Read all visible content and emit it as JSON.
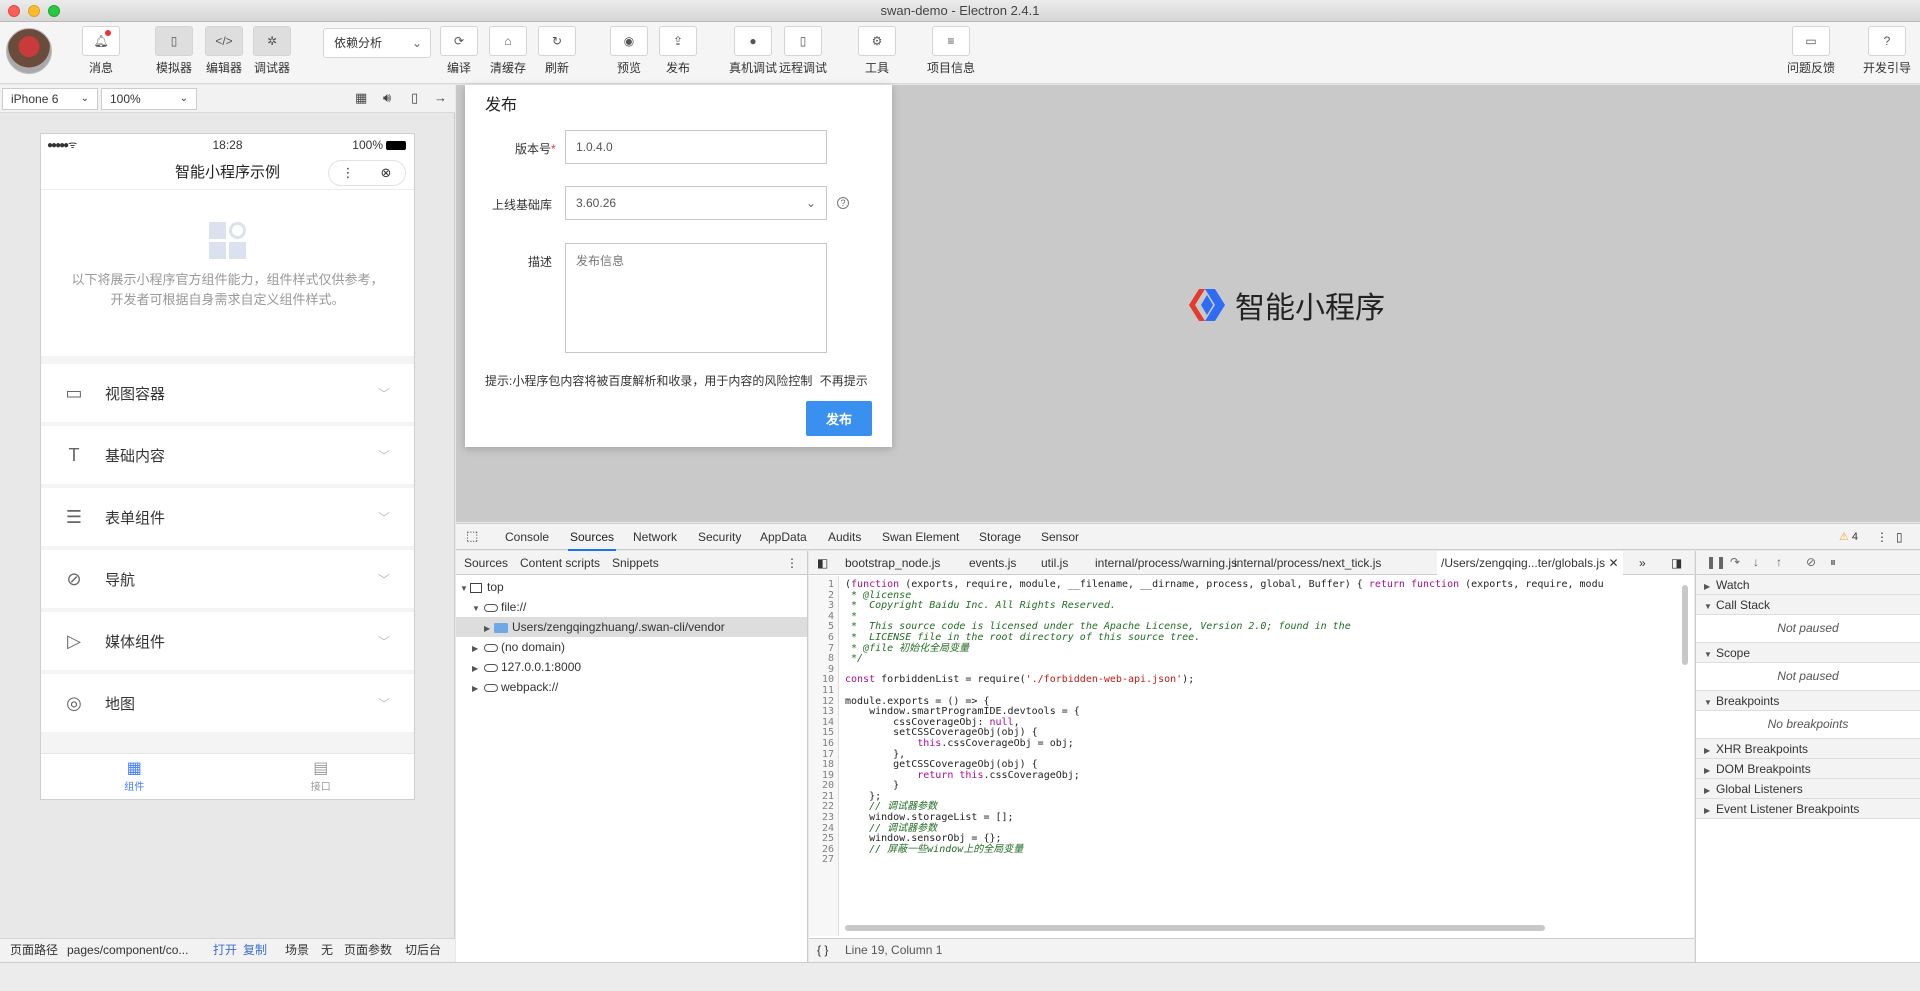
{
  "window": {
    "title": "swan-demo - Electron 2.4.1"
  },
  "toolbar": {
    "message": "消息",
    "simulator": "模拟器",
    "editor": "编辑器",
    "debugger": "调试器",
    "compile_mode": "依赖分析",
    "compile": "编译",
    "clear_cache": "清缓存",
    "refresh": "刷新",
    "preview": "预览",
    "publish": "发布",
    "device_debug": "真机调试",
    "remote_debug": "远程调试",
    "tools": "工具",
    "project_info": "项目信息",
    "feedback": "问题反馈",
    "dev_guide": "开发引导"
  },
  "simulator": {
    "device": "iPhone 6",
    "zoom": "100%"
  },
  "phone": {
    "status_time": "18:28",
    "battery": "100%",
    "signal": "●●●●● ᯤ",
    "nav_title": "智能小程序示例",
    "capsule_menu": "⋮",
    "capsule_close": "⊗",
    "intro_line1": "以下将展示小程序官方组件能力，组件样式仅供参考，",
    "intro_line2": "开发者可根据自身需求自定义组件样式。",
    "items": [
      {
        "label": "视图容器"
      },
      {
        "label": "基础内容"
      },
      {
        "label": "表单组件"
      },
      {
        "label": "导航"
      },
      {
        "label": "媒体组件"
      },
      {
        "label": "地图"
      }
    ],
    "tabs": [
      {
        "label": "组件"
      },
      {
        "label": "接口"
      }
    ]
  },
  "sim_footer": {
    "path_label": "页面路径",
    "path_value": "pages/component/co...",
    "open": "打开",
    "copy": "复制",
    "scene": "场景",
    "scene_value": "无",
    "page_params": "页面参数",
    "background": "切后台"
  },
  "publish_dialog": {
    "title": "发布",
    "version_label": "版本号",
    "required_mark": "*",
    "version_value": "1.0.4.0",
    "lib_label": "上线基础库",
    "lib_value": "3.60.26",
    "desc_label": "描述",
    "desc_placeholder": "发布信息",
    "hint": "提示:小程序包内容将被百度解析和收录，用于内容的风险控制",
    "dismiss": "不再提示",
    "submit": "发布"
  },
  "brand": {
    "name": "智能小程序"
  },
  "devtools": {
    "tabs": [
      "Console",
      "Sources",
      "Network",
      "Security",
      "AppData",
      "Audits",
      "Swan Element",
      "Storage",
      "Sensor"
    ],
    "active_tab": "Sources",
    "warnings": "4",
    "nav_tabs": [
      "Sources",
      "Content scripts",
      "Snippets"
    ],
    "tree": {
      "top": "top",
      "file": "file://",
      "folder": "Users/zengqingzhuang/.swan-cli/vendor",
      "no_domain": "(no domain)",
      "local": "127.0.0.1:8000",
      "webpack": "webpack://"
    },
    "files": [
      "bootstrap_node.js",
      "events.js",
      "util.js",
      "internal/process/warning.js",
      "internal/process/next_tick.js",
      "/Users/zengqing...ter/globals.js"
    ],
    "cursor": "Line 19, Column 1",
    "format_btn": "{ }",
    "debug_sections": {
      "watch": "Watch",
      "call_stack": "Call Stack",
      "not_paused_1": "Not paused",
      "scope": "Scope",
      "not_paused_2": "Not paused",
      "breakpoints": "Breakpoints",
      "no_breakpoints": "No breakpoints",
      "xhr": "XHR Breakpoints",
      "dom": "DOM Breakpoints",
      "global": "Global Listeners",
      "event": "Event Listener Breakpoints"
    }
  }
}
